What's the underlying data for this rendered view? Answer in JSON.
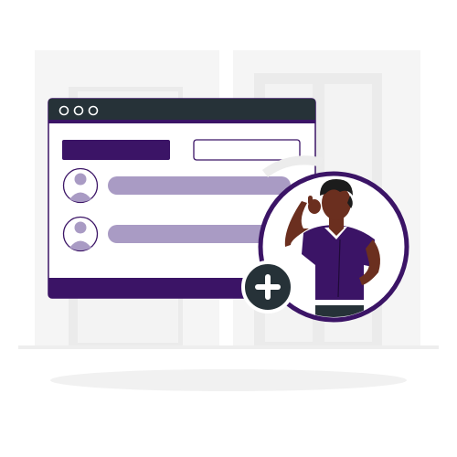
{
  "illustration": {
    "window": {
      "controls": [
        "close",
        "minimize",
        "maximize"
      ],
      "toolbar": {
        "primary_bar": "filled",
        "secondary_bar": "outlined"
      },
      "list_items": [
        {
          "avatar": "user-avatar-icon"
        },
        {
          "avatar": "user-avatar-icon"
        }
      ]
    },
    "badge": {
      "icon": "plus-icon"
    },
    "person": {
      "pose": "thinking"
    }
  },
  "colors": {
    "accent": "#3b1466",
    "accent_light": "#a99bc4",
    "dark": "#263238",
    "skin": "#6b2f1f",
    "hair": "#1c1c1c",
    "bg_shape": "#f2f2f2",
    "bg_shape_dark": "#e9e9e9",
    "shadow": "#f1f1f1",
    "white": "#ffffff"
  }
}
